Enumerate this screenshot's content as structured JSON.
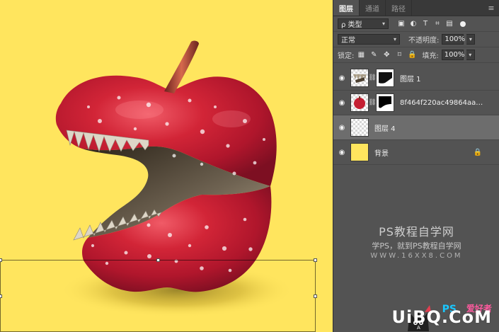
{
  "panel": {
    "tabs": [
      {
        "label": "图层"
      },
      {
        "label": "通道"
      },
      {
        "label": "路径"
      }
    ],
    "filter": {
      "type_label": "ρ 类型"
    },
    "blend": {
      "mode": "正常",
      "opacity_label": "不透明度:",
      "opacity_value": "100%"
    },
    "locks": {
      "label": "锁定:",
      "fill_label": "填充:",
      "fill_value": "100%"
    },
    "layers": [
      {
        "name": "图层 1",
        "selected": false
      },
      {
        "name": "8f464f220ac49864aa02...",
        "selected": false
      },
      {
        "name": "图层 4",
        "selected": true
      },
      {
        "name": "背景",
        "selected": false
      }
    ]
  },
  "watermark": {
    "title": "PS教程自学网",
    "subtitle": "学PS，就到PS教程自学网",
    "url": "WWW.16XX8.COM"
  },
  "brand": {
    "text": "UiBQ.CoM",
    "ps": "PS",
    "love": "爱好者"
  },
  "colors": {
    "canvas_bg": "#ffe55e",
    "panel_bg": "#535353",
    "selected_row": "#6d6d6d",
    "apple_red": "#c51f32"
  }
}
